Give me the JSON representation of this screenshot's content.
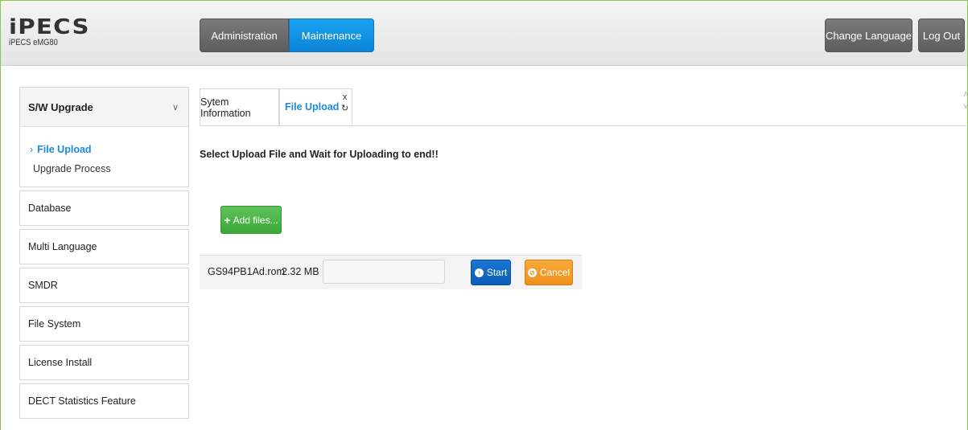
{
  "brand": {
    "logo": "iPECS",
    "subtitle": "iPECS eMG80"
  },
  "nav": {
    "administration": "Administration",
    "maintenance": "Maintenance"
  },
  "header_buttons": {
    "change_language": "Change Language",
    "log_out": "Log Out"
  },
  "sidebar": {
    "group": {
      "title": "S/W Upgrade",
      "items": [
        {
          "label": "File Upload",
          "active": true
        },
        {
          "label": "Upgrade Process",
          "active": false
        }
      ]
    },
    "items": [
      {
        "label": "Database"
      },
      {
        "label": "Multi Language"
      },
      {
        "label": "SMDR"
      },
      {
        "label": "File System"
      },
      {
        "label": "License Install"
      },
      {
        "label": "DECT Statistics Feature"
      }
    ]
  },
  "tabs": [
    {
      "label": "Sytem Information"
    },
    {
      "label": "File Upload",
      "active": true
    }
  ],
  "tab_controls": {
    "close": "x",
    "refresh": "↻"
  },
  "main": {
    "instruction": "Select Upload File and Wait for Uploading to end!!",
    "add_files_label": "Add files...",
    "file": {
      "name": "GS94PB1Ad.rom",
      "size": "2.32 MB",
      "progress": 0
    },
    "start_label": "Start",
    "cancel_label": "Cancel"
  },
  "colors": {
    "accent_blue": "#1a8ad9",
    "maintenance_tab": "#0b84d6",
    "add_button": "#3ba838",
    "start_button": "#0d5db8",
    "cancel_button": "#f0901a"
  }
}
